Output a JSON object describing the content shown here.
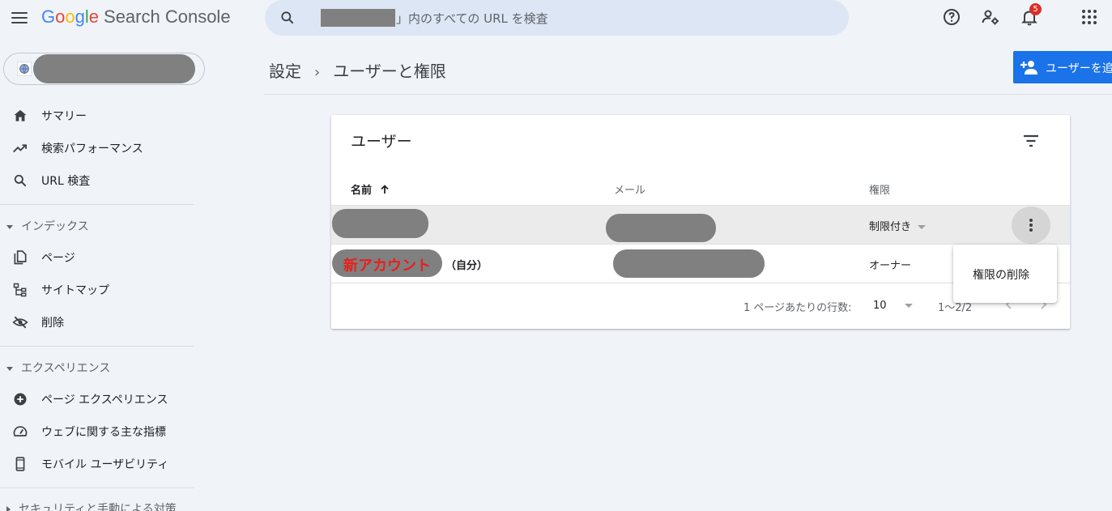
{
  "header": {
    "product_name": "Search Console",
    "search_placeholder": "」内のすべての URL を検査",
    "notification_count": "5"
  },
  "sidebar": {
    "nav": [
      {
        "label": "サマリー",
        "icon": "home-icon"
      },
      {
        "label": "検索パフォーマンス",
        "icon": "trending-up-icon"
      },
      {
        "label": "URL 検査",
        "icon": "search-icon"
      }
    ],
    "sections": [
      {
        "title": "インデックス",
        "items": [
          {
            "label": "ページ",
            "icon": "pages-icon"
          },
          {
            "label": "サイトマップ",
            "icon": "sitemap-icon"
          },
          {
            "label": "削除",
            "icon": "visibility-off-icon"
          }
        ]
      },
      {
        "title": "エクスペリエンス",
        "items": [
          {
            "label": "ページ エクスペリエンス",
            "icon": "page-experience-icon"
          },
          {
            "label": "ウェブに関する主な指標",
            "icon": "speed-icon"
          },
          {
            "label": "モバイル ユーザビリティ",
            "icon": "smartphone-icon"
          }
        ]
      },
      {
        "title": "セキュリティと手動による対策"
      }
    ]
  },
  "breadcrumb": {
    "parent": "設定",
    "current": "ユーザーと権限"
  },
  "add_user_button": "ユーザーを追加",
  "users_card": {
    "title": "ユーザー",
    "columns": {
      "name": "名前",
      "email": "メール",
      "permission": "権限"
    },
    "rows": [
      {
        "name": "",
        "email": "",
        "permission": "制限付き"
      },
      {
        "name": "新アカウント",
        "self_tag": "（自分）",
        "email": "",
        "permission": "オーナー"
      }
    ],
    "footer": {
      "rows_per_page_label": "1 ページあたりの行数:",
      "rows_per_page_value": "10",
      "range": "1〜2/2"
    },
    "menu": {
      "remove_permission": "権限の削除"
    }
  },
  "colors": {
    "accent": "#1a73e8",
    "badge": "#d93025",
    "new_account_text": "#e8201a"
  }
}
